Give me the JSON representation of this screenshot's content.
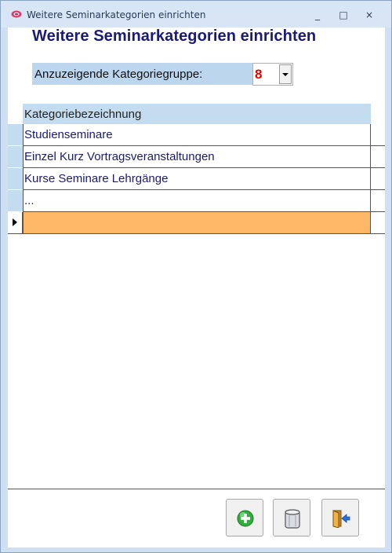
{
  "window": {
    "title": "Weitere Seminarkategorien einrichten",
    "minimize_glyph": "_",
    "maximize_glyph": "□",
    "close_glyph": "×"
  },
  "form": {
    "heading": "Weitere Seminarkategorien einrichten",
    "group_label": "Anzuzeigende Kategoriegruppe:",
    "group_value": "8"
  },
  "grid": {
    "column_header": "Kategoriebezeichnung",
    "rows": [
      "Studienseminare",
      "Einzel Kurz Vortragsveranstaltungen",
      "Kurse Seminare Lehrgänge",
      "..."
    ],
    "new_row_value": ""
  },
  "toolbar": {
    "buttons": [
      "add-icon",
      "delete-icon",
      "exit-icon"
    ]
  },
  "colors": {
    "heading": "#1a1a78",
    "group_value": "#e00000",
    "new_row_highlight": "#ffb866",
    "header_bg": "#c4dcf0"
  }
}
